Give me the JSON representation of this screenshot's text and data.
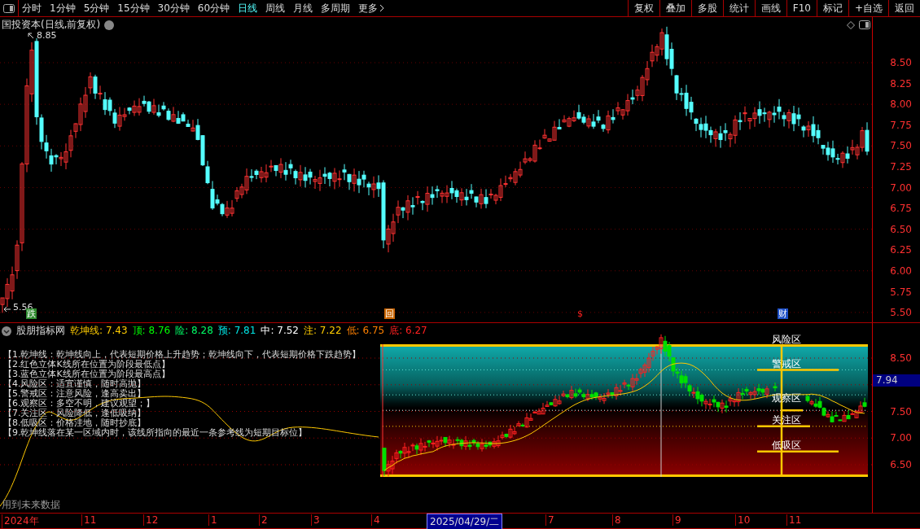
{
  "toolbar": {
    "periods": [
      {
        "label": "分时",
        "selected": false
      },
      {
        "label": "1分钟",
        "selected": false
      },
      {
        "label": "5分钟",
        "selected": false
      },
      {
        "label": "15分钟",
        "selected": false
      },
      {
        "label": "30分钟",
        "selected": false
      },
      {
        "label": "60分钟",
        "selected": false
      },
      {
        "label": "日线",
        "selected": true
      },
      {
        "label": "周线",
        "selected": false
      },
      {
        "label": "月线",
        "selected": false
      },
      {
        "label": "多周期",
        "selected": false
      },
      {
        "label": "更多",
        "selected": false
      }
    ],
    "buttons": [
      "复权",
      "叠加",
      "多股",
      "统计",
      "画线",
      "F10",
      "标记",
      "+自选",
      "返回"
    ]
  },
  "main_chart": {
    "title": "国投资本(日线,前复权)",
    "high_label": "8.85",
    "low_label": "5.56",
    "price_axis": [
      "8.50",
      "8.25",
      "8.00",
      "7.75",
      "7.50",
      "7.25",
      "7.00",
      "6.75",
      "6.50",
      "6.25",
      "6.00",
      "5.75",
      "5.50"
    ],
    "markers": [
      {
        "text": "跌",
        "color": "#2e8b2e"
      },
      {
        "text": "回",
        "color": "#c86400"
      },
      {
        "text": "$",
        "color": "#ff2020"
      },
      {
        "text": "财",
        "color": "#1e50c8"
      }
    ]
  },
  "indicator": {
    "name": "股朋指标网",
    "values": [
      {
        "label": "乾坤线:",
        "value": "7.43",
        "color": "#ffcc00"
      },
      {
        "label": "顶:",
        "value": "8.76",
        "color": "#00ff00"
      },
      {
        "label": "险:",
        "value": "8.28",
        "color": "#00ff66"
      },
      {
        "label": "预:",
        "value": "7.81",
        "color": "#00e5e5"
      },
      {
        "label": "中:",
        "value": "7.52",
        "color": "#ffffff"
      },
      {
        "label": "注:",
        "value": "7.22",
        "color": "#ffcc00"
      },
      {
        "label": "低:",
        "value": "6.75",
        "color": "#ff8000"
      },
      {
        "label": "底:",
        "value": "6.27",
        "color": "#ff2020"
      }
    ],
    "notes": [
      "【1.乾坤线：乾坤线向上，代表短期价格上升趋势；乾坤线向下，代表短期价格下跌趋势】",
      "【2.红色立体K线所在位置为阶段最低点】",
      "【3.蓝色立体K线所在位置为阶段最高点】",
      "【4.风险区：适宜谨慎，随时高抛】",
      "【5.警戒区：注意风险，逢高卖出】",
      "【6.观察区：多空不明，建议观望；】",
      "【7.关注区：风险降低，逢低吸纳】",
      "【8.低吸区：价格洼地，随时抄底】",
      "【9.乾坤线落在某一区域内时，该线所指向的最近一条参考线为短期目标位】"
    ],
    "zones": [
      "风险区",
      "警戒区",
      "观察区",
      "关注区",
      "低吸区"
    ],
    "axis": [
      "8.50",
      "7.50",
      "7.00",
      "6.50"
    ],
    "current_value": "7.94",
    "footer_note": "用到未来数据"
  },
  "date_axis": {
    "labels": [
      "2024年",
      "11",
      "12",
      "1",
      "2",
      "3",
      "4",
      "7",
      "8",
      "9",
      "10",
      "11"
    ],
    "cursor_date": "2025/04/29/二"
  }
}
